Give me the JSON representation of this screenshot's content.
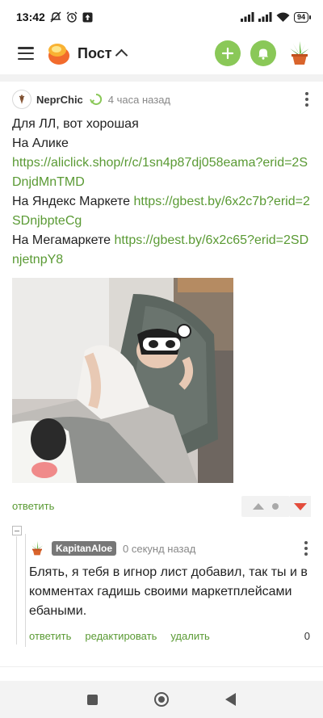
{
  "status_bar": {
    "time": "13:42",
    "battery": "94",
    "icons": [
      "mute-icon",
      "alarm-icon",
      "upload-icon",
      "signal-icon",
      "signal-icon",
      "wifi-icon",
      "battery-icon"
    ]
  },
  "app_bar": {
    "title": "Пост",
    "icons": [
      "menu-icon",
      "app-logo",
      "chevron-up-icon",
      "plus-icon",
      "bell-icon",
      "plant-avatar-icon"
    ],
    "accent_color": "#8ac858"
  },
  "post": {
    "author": "NeprChic",
    "time": "4 часа назад",
    "lines": {
      "l1": "Для ЛЛ, вот хорошая",
      "l2": "На Алике",
      "link1": "https://aliclick.shop/r/c/1sn4p87dj058eama?erid=2SDnjdMnTMD",
      "l3_prefix": "На Яндекс Маркете ",
      "link2": "https://gbest.by/6x2c7b?erid=2SDnjbpteCg",
      "l4_prefix": "На Мегамаркете ",
      "link3": "https://gbest.by/6x2c65?erid=2SDnjetnpY8"
    },
    "reply_label": "ответить",
    "link_color": "#5a9a34",
    "downvote_color": "#e34c3c"
  },
  "comment": {
    "author": "KapitanAloe",
    "time": "0 секунд назад",
    "text": "Блять, я тебя в игнор лист добавил, так ты и в комментах гадишь своими маркетплейсами ебаными.",
    "actions": {
      "reply": "ответить",
      "edit": "редактировать",
      "delete": "удалить"
    },
    "score": "0"
  },
  "nav_bar": {
    "icons": [
      "recents-icon",
      "home-icon",
      "back-icon"
    ]
  }
}
